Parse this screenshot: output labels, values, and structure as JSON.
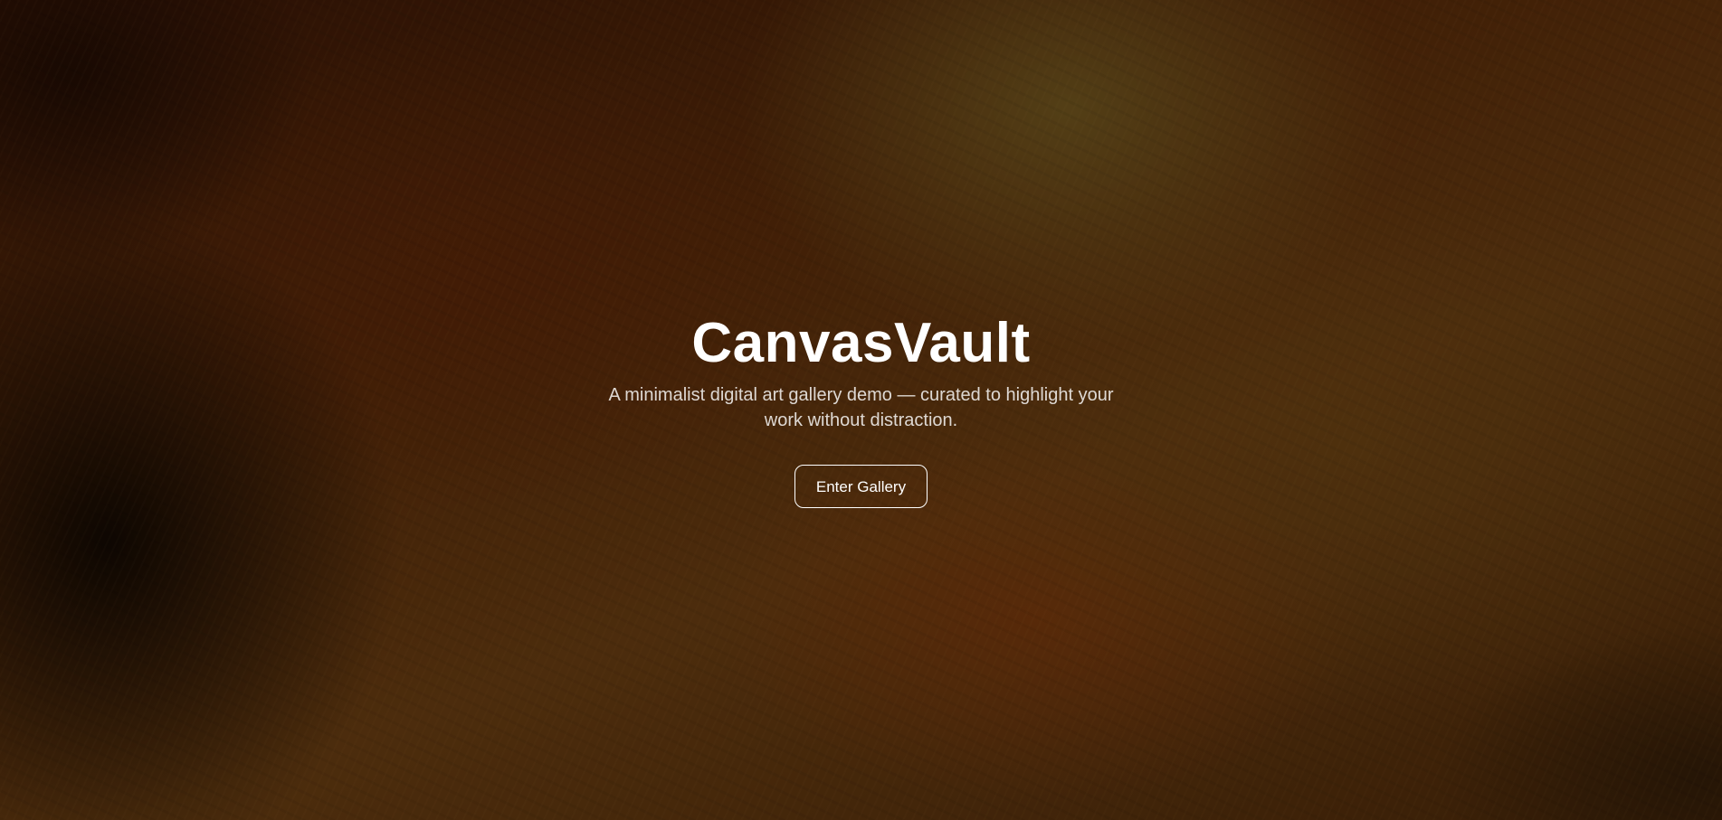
{
  "hero": {
    "title": "CanvasVault",
    "subtitle": "A minimalist digital art gallery demo — curated to highlight your work without distraction.",
    "cta_label": "Enter Gallery"
  },
  "colors": {
    "background_base": "#4a2608",
    "title_text": "#ffffff",
    "button_border": "#ffffff"
  }
}
